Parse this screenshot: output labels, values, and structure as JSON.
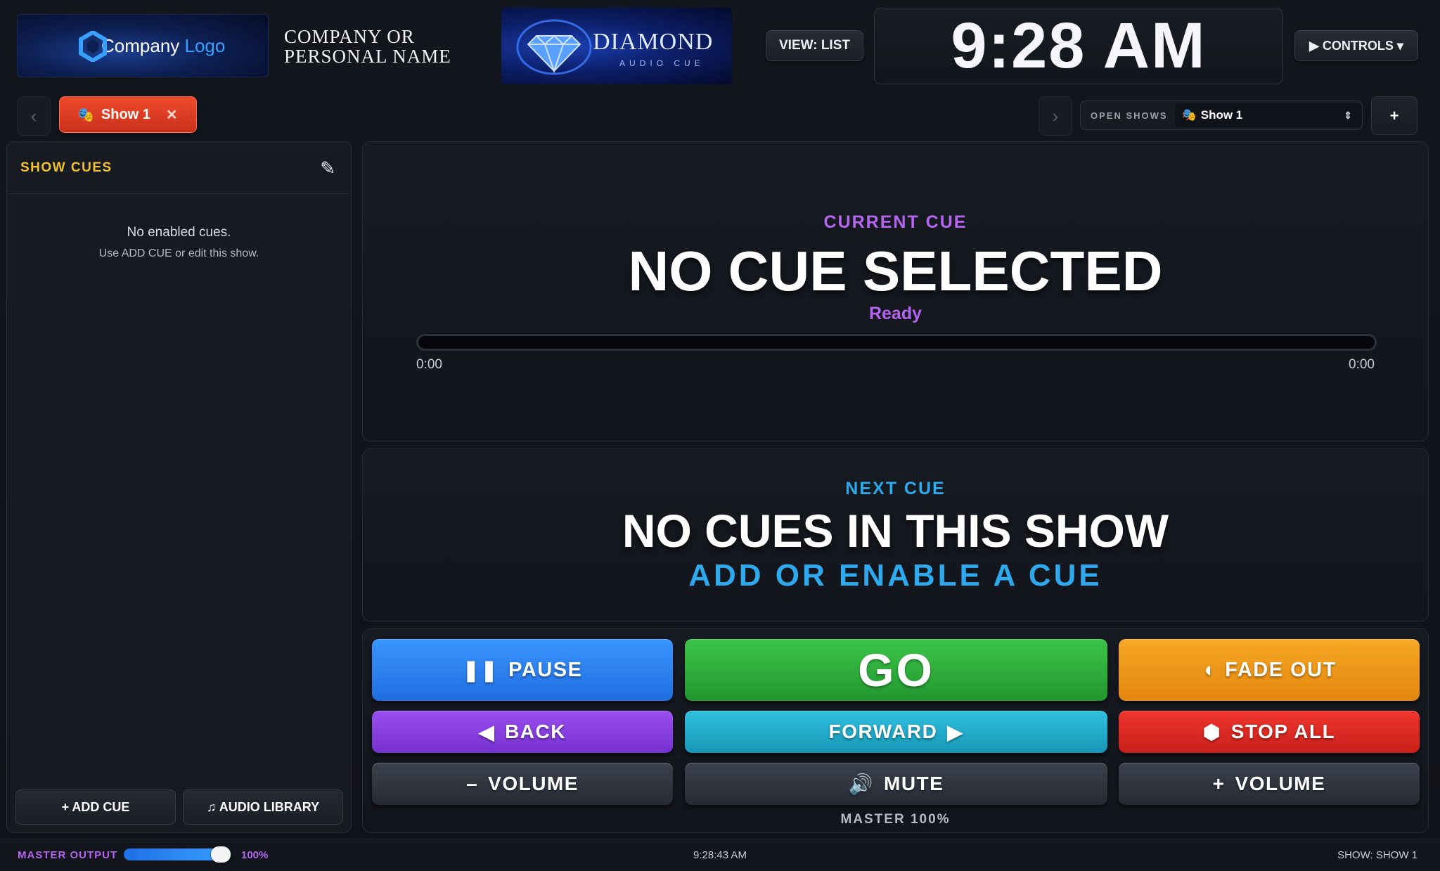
{
  "header": {
    "logo": {
      "text_main": "Company ",
      "text_accent": "Logo"
    },
    "company_name": "COMPANY OR PERSONAL NAME",
    "brand": {
      "title": "DIAMOND",
      "subtitle": "AUDIO CUE"
    },
    "view_button": "VIEW: LIST",
    "clock": "9:28 AM",
    "controls_button": "▶ CONTROLS ▾"
  },
  "tabs": {
    "prev_icon": "chevron-left-icon",
    "next_icon": "chevron-right-icon",
    "active_tab": {
      "icon": "theater-masks-icon",
      "label": "Show 1",
      "close": "✕"
    },
    "open_shows": {
      "label": "OPEN SHOWS",
      "selected": "Show 1"
    },
    "add_show": "+"
  },
  "sidebar": {
    "title": "SHOW CUES",
    "edit_icon": "pencil-icon",
    "empty_title": "No enabled cues.",
    "empty_subtitle": "Use ADD CUE or edit this show.",
    "add_cue": "+ ADD CUE",
    "audio_library": "♫ AUDIO LIBRARY"
  },
  "current_cue": {
    "label": "CURRENT CUE",
    "title": "NO CUE SELECTED",
    "status": "Ready",
    "progress": 0,
    "elapsed": "0:00",
    "duration": "0:00"
  },
  "next_cue": {
    "label": "NEXT CUE",
    "title": "NO CUES IN THIS SHOW",
    "subtitle": "ADD OR ENABLE A CUE"
  },
  "transport": {
    "pause": "PAUSE",
    "go": "GO",
    "fade_out": "FADE OUT",
    "back": "BACK",
    "forward": "FORWARD",
    "stop_all": "STOP ALL",
    "volume_down": "VOLUME",
    "mute": "MUTE",
    "volume_up": "VOLUME",
    "master_level": "MASTER 100%"
  },
  "status_bar": {
    "master_label": "MASTER OUTPUT",
    "master_value": 1.0,
    "master_pct": "100%",
    "time": "9:28:43 AM",
    "show": "SHOW: SHOW 1"
  },
  "colors": {
    "background": "#0f1218",
    "accent_purple": "#b565f0",
    "accent_blue": "#2ea9ee",
    "accent_yellow": "#f2c232",
    "pause": "#2a82f5",
    "go": "#30b03c",
    "fade_out": "#f09a1c",
    "back": "#8a40e0",
    "forward": "#23acc8",
    "stop_all": "#e02b24"
  }
}
